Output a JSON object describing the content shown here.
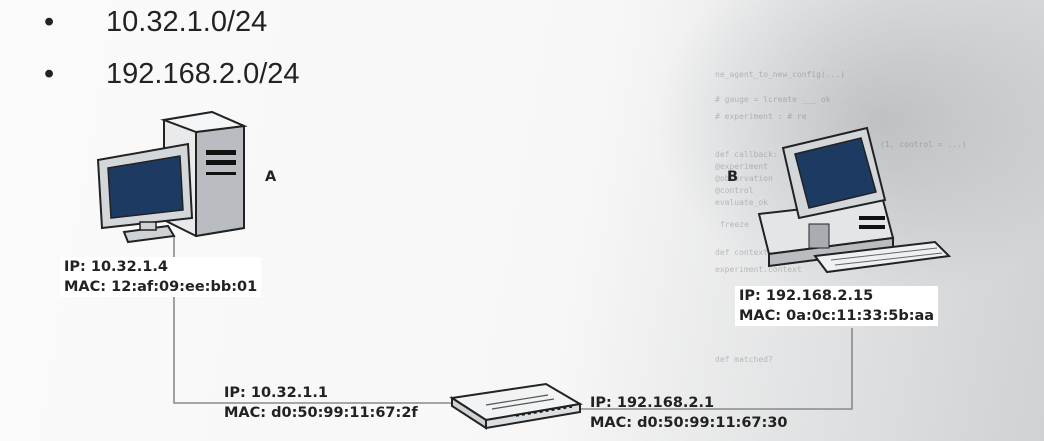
{
  "bullets": [
    "10.32.1.0/24",
    "192.168.2.0/24"
  ],
  "host_a": {
    "name": "A",
    "ip": "IP: 10.32.1.4",
    "mac": "MAC: 12:af:09:ee:bb:01"
  },
  "host_b": {
    "name": "B",
    "ip": "IP: 192.168.2.15",
    "mac": "MAC: 0a:0c:11:33:5b:aa"
  },
  "router_left": {
    "ip": "IP: 10.32.1.1",
    "mac": "MAC: d0:50:99:11:67:2f"
  },
  "router_right": {
    "ip": "IP: 192.168.2.1",
    "mac": "MAC: d0:50:99:11:67:30"
  },
  "icons": [
    "computer-a-icon",
    "computer-b-icon",
    "router-icon"
  ],
  "colors": {
    "screen": "#1d3a63",
    "case": "#c9ccd0",
    "wire": "#8a8a8a"
  }
}
